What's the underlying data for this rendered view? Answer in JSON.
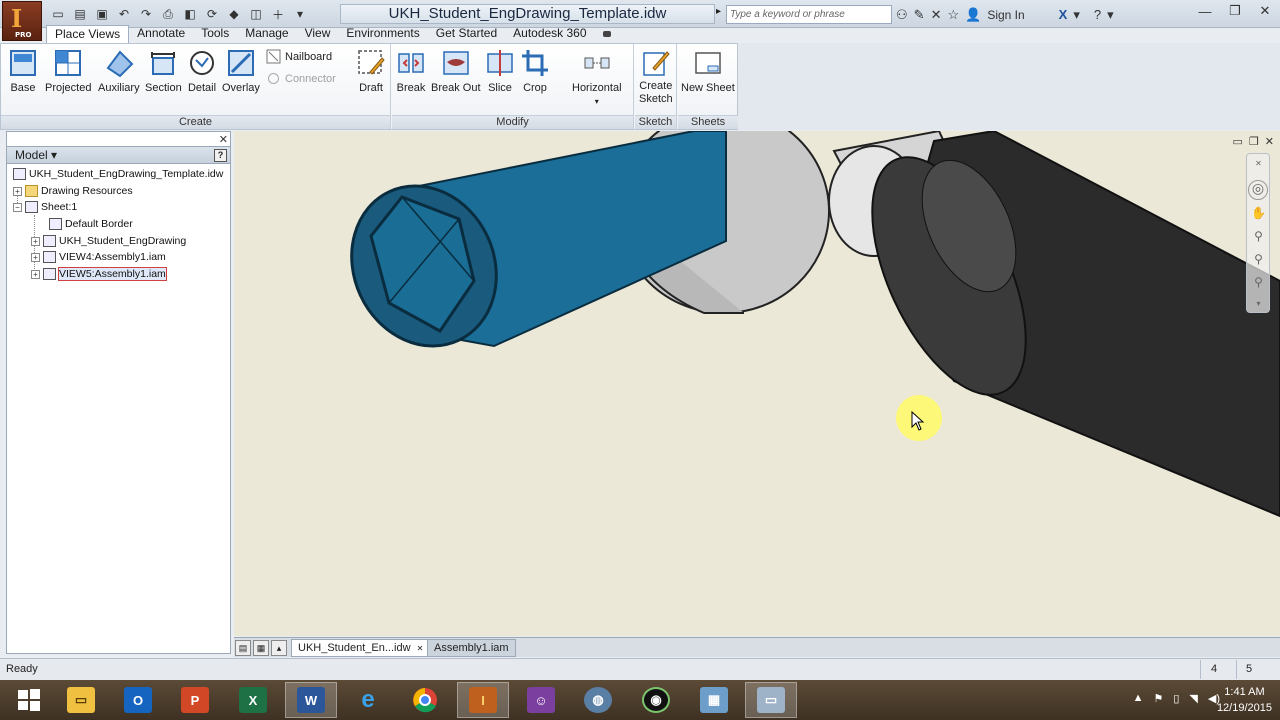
{
  "app": {
    "logo_letter": "I",
    "logo_edition": "PRO"
  },
  "title_bar": {
    "document_title": "UKH_Student_EngDrawing_Template.idw",
    "search_placeholder": "Type a keyword or phrase",
    "sign_in": "Sign In"
  },
  "menu_tabs": [
    "Place Views",
    "Annotate",
    "Tools",
    "Manage",
    "View",
    "Environments",
    "Get Started",
    "Autodesk 360"
  ],
  "ribbon": {
    "create": {
      "title": "Create",
      "buttons": [
        "Base",
        "Projected",
        "Auxiliary",
        "Section",
        "Detail",
        "Overlay"
      ],
      "nailboard": "Nailboard",
      "connector": "Connector",
      "draft": "Draft"
    },
    "modify": {
      "title": "Modify",
      "buttons": [
        "Break",
        "Break Out",
        "Slice",
        "Crop"
      ],
      "horizontal": "Horizontal"
    },
    "sketch": {
      "title": "Sketch",
      "button_line1": "Create",
      "button_line2": "Sketch"
    },
    "sheets": {
      "title": "Sheets",
      "button": "New Sheet"
    }
  },
  "browser": {
    "title": "Model",
    "items": [
      {
        "label": "UKH_Student_EngDrawing_Template.idw"
      },
      {
        "label": "Drawing Resources"
      },
      {
        "label": "Sheet:1"
      },
      {
        "label": "Default Border"
      },
      {
        "label": "UKH_Student_EngDrawing"
      },
      {
        "label": "VIEW4:Assembly1.iam"
      },
      {
        "label": "VIEW5:Assembly1.iam"
      }
    ]
  },
  "doc_tabs": [
    "UKH_Student_En...idw",
    "Assembly1.iam"
  ],
  "status": {
    "text": "Ready",
    "value1": "4",
    "value2": "5"
  },
  "taskbar": {
    "apps": [
      "start-button",
      "file-explorer",
      "outlook",
      "powerpoint",
      "excel",
      "word",
      "internet-explorer",
      "chrome",
      "inventor",
      "teams",
      "app-globe",
      "app-camera",
      "app-network",
      "app-screenshot"
    ],
    "time": "1:41 AM",
    "date": "12/19/2015"
  }
}
